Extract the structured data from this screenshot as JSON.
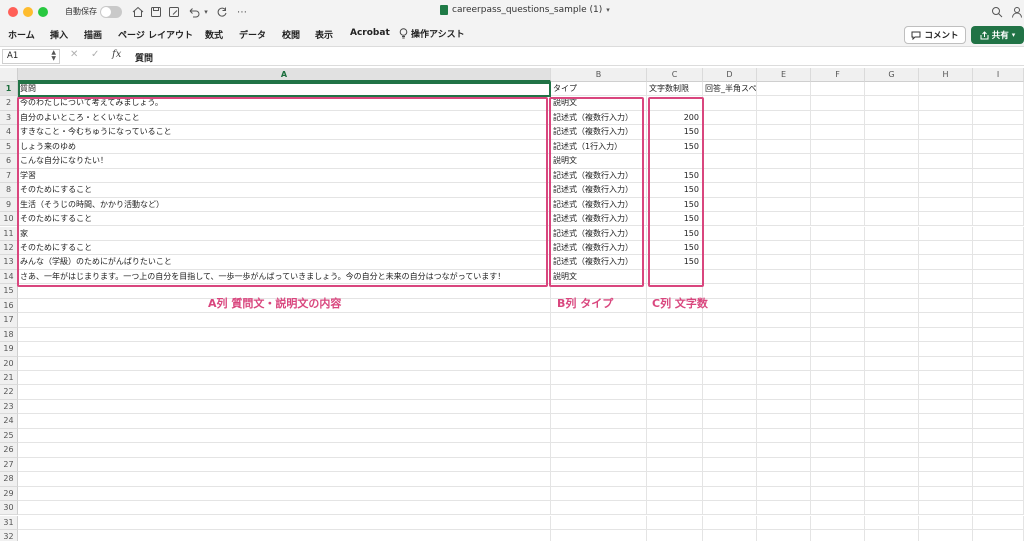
{
  "titlebar": {
    "autosave_label": "自動保存",
    "document_title": "careerpass_questions_sample (1)",
    "icons": [
      "home-icon",
      "save-icon",
      "save-as-icon",
      "undo-icon",
      "redo-icon",
      "more-icon",
      "search-icon",
      "person-icon"
    ]
  },
  "ribbon": {
    "tabs": [
      "ホーム",
      "挿入",
      "描画",
      "ページ レイアウト",
      "数式",
      "データ",
      "校閲",
      "表示",
      "Acrobat"
    ],
    "tell_me": "操作アシスト",
    "comment_label": "コメント",
    "share_label": "共有"
  },
  "formula_bar": {
    "name_box": "A1",
    "fx_label": "fx",
    "content": "質問"
  },
  "sheet": {
    "columns": [
      "A",
      "B",
      "C",
      "D",
      "E",
      "F",
      "G",
      "H",
      "I"
    ],
    "rows": [
      {
        "a": "質問",
        "b": "タイプ",
        "c": "文字数制限",
        "d": "回答_半角スペース区切り_"
      },
      {
        "a": "今のわたしについて考えてみましょう。",
        "b": "説明文",
        "c": "",
        "d": ""
      },
      {
        "a": "自分のよいところ・とくいなこと",
        "b": "記述式（複数行入力）",
        "c": "200",
        "d": ""
      },
      {
        "a": "すきなこと・今むちゅうになっていること",
        "b": "記述式（複数行入力）",
        "c": "150",
        "d": ""
      },
      {
        "a": "しょう来のゆめ",
        "b": "記述式（1行入力）",
        "c": "150",
        "d": ""
      },
      {
        "a": "こんな自分になりたい！",
        "b": "説明文",
        "c": "",
        "d": ""
      },
      {
        "a": "学習",
        "b": "記述式（複数行入力）",
        "c": "150",
        "d": ""
      },
      {
        "a": "そのためにすること",
        "b": "記述式（複数行入力）",
        "c": "150",
        "d": ""
      },
      {
        "a": "生活（そうじの時間、かかり活動など）",
        "b": "記述式（複数行入力）",
        "c": "150",
        "d": ""
      },
      {
        "a": "そのためにすること",
        "b": "記述式（複数行入力）",
        "c": "150",
        "d": ""
      },
      {
        "a": "家",
        "b": "記述式（複数行入力）",
        "c": "150",
        "d": ""
      },
      {
        "a": "そのためにすること",
        "b": "記述式（複数行入力）",
        "c": "150",
        "d": ""
      },
      {
        "a": "みんな（学級）のためにがんばりたいこと",
        "b": "記述式（複数行入力）",
        "c": "150",
        "d": ""
      },
      {
        "a": "さあ、一年がはじまります。一つ上の自分を目指して、一歩一歩がんばっていきましょう。今の自分と未来の自分はつながっています！",
        "b": "説明文",
        "c": "",
        "d": ""
      }
    ],
    "row_count": 32
  },
  "annotations": {
    "col_a": "A列 質問文・説明文の内容",
    "col_b": "B列 タイプ",
    "col_c": "C列 文字数",
    "color": "#d9467e"
  }
}
